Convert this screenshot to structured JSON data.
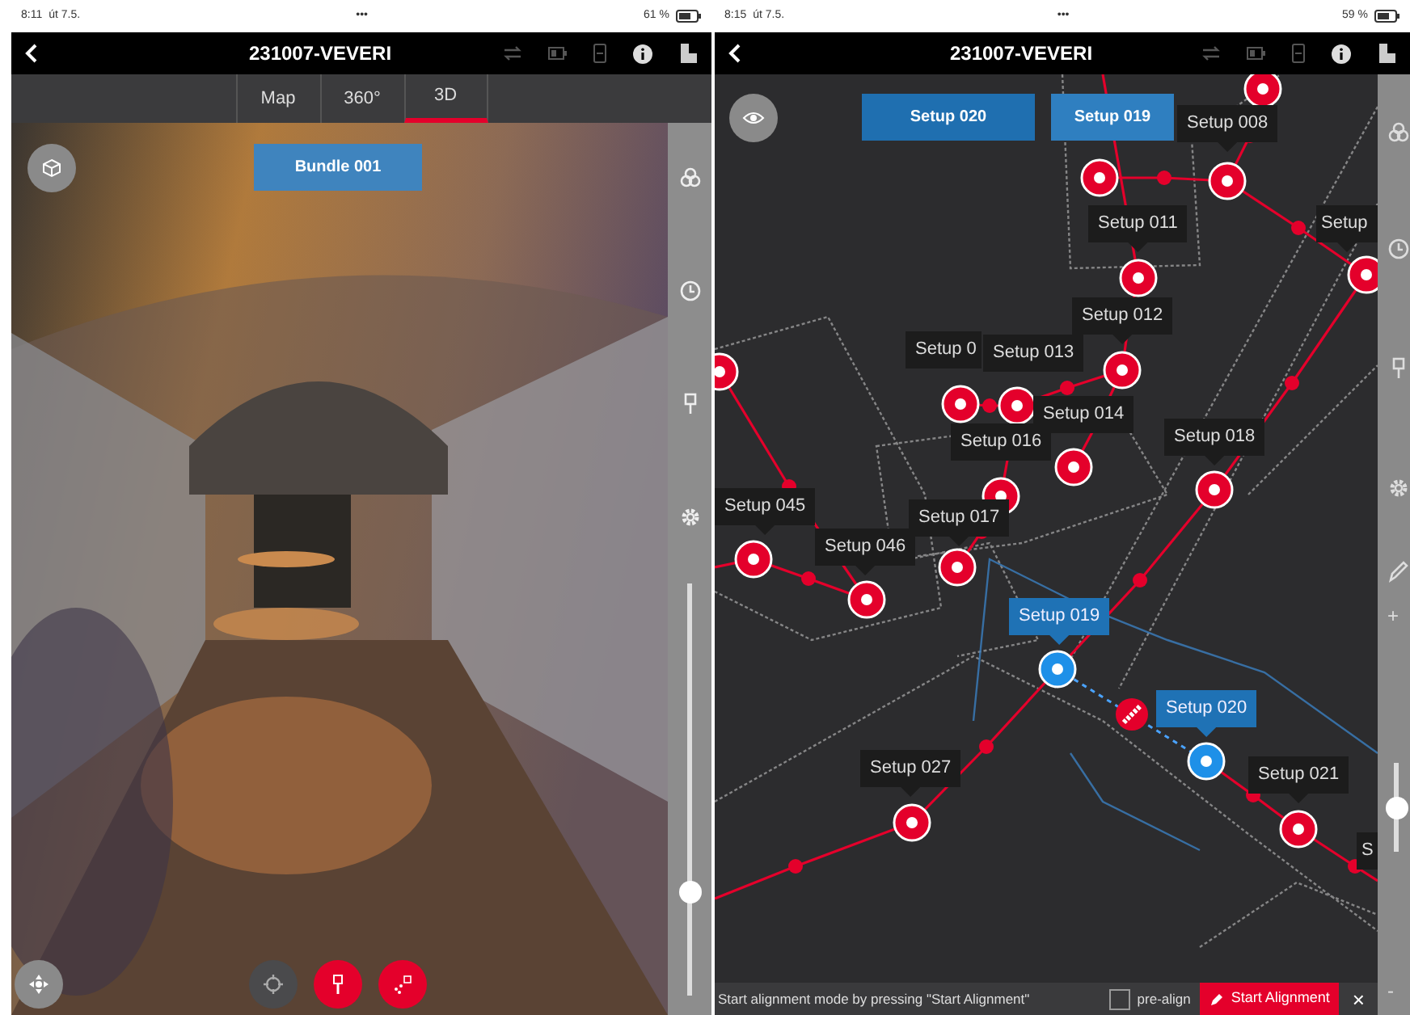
{
  "left_screen": {
    "status_bar": {
      "time": "8:11",
      "date": "út 7.5.",
      "dots": "•••",
      "battery": "61 %"
    },
    "header": {
      "title": "231007-VEVERI"
    },
    "tabs": [
      {
        "label": "Map",
        "selected": false
      },
      {
        "label": "360°",
        "selected": false
      },
      {
        "label": "3D",
        "selected": true
      }
    ],
    "bundle_label": "Bundle 001",
    "tool_buttons": [
      {
        "kind": "target",
        "on": false
      },
      {
        "kind": "pin",
        "on": true
      },
      {
        "kind": "scatter",
        "on": true
      }
    ],
    "slider": {
      "level": 0.25
    }
  },
  "right_screen": {
    "status_bar": {
      "time": "8:15",
      "date": "út 7.5.",
      "dots": "•••",
      "battery": "59 %"
    },
    "header": {
      "title": "231007-VEVERI"
    },
    "setup_buttons": [
      {
        "label": "Setup 020"
      },
      {
        "label": "Setup 019"
      }
    ],
    "map_labels": [
      {
        "text": "Setup 008",
        "selected": false
      },
      {
        "text": "Setup 011",
        "selected": false
      },
      {
        "text": "Setup",
        "selected": false
      },
      {
        "text": "Setup 012",
        "selected": false
      },
      {
        "text": "Setup 0",
        "selected": false
      },
      {
        "text": "Setup 013",
        "selected": false
      },
      {
        "text": "Setup 014",
        "selected": false
      },
      {
        "text": "Setup 016",
        "selected": false
      },
      {
        "text": "Setup 018",
        "selected": false
      },
      {
        "text": "Setup 045",
        "selected": false
      },
      {
        "text": "Setup 046",
        "selected": false
      },
      {
        "text": "Setup 017",
        "selected": false
      },
      {
        "text": "Setup 019",
        "selected": true
      },
      {
        "text": "Setup 020",
        "selected": true
      },
      {
        "text": "Setup 027",
        "selected": false
      },
      {
        "text": "Setup 021",
        "selected": false
      },
      {
        "text": "S",
        "selected": false
      }
    ],
    "zoom": {
      "plus": "+",
      "minus": "-",
      "level": 0.5
    },
    "bottom_bar": {
      "hint": "Start alignment mode by pressing \"Start Alignment\"",
      "pre_align": {
        "label": "pre-align",
        "checked": false
      },
      "start_button": "Start Alignment",
      "close": "×"
    }
  }
}
